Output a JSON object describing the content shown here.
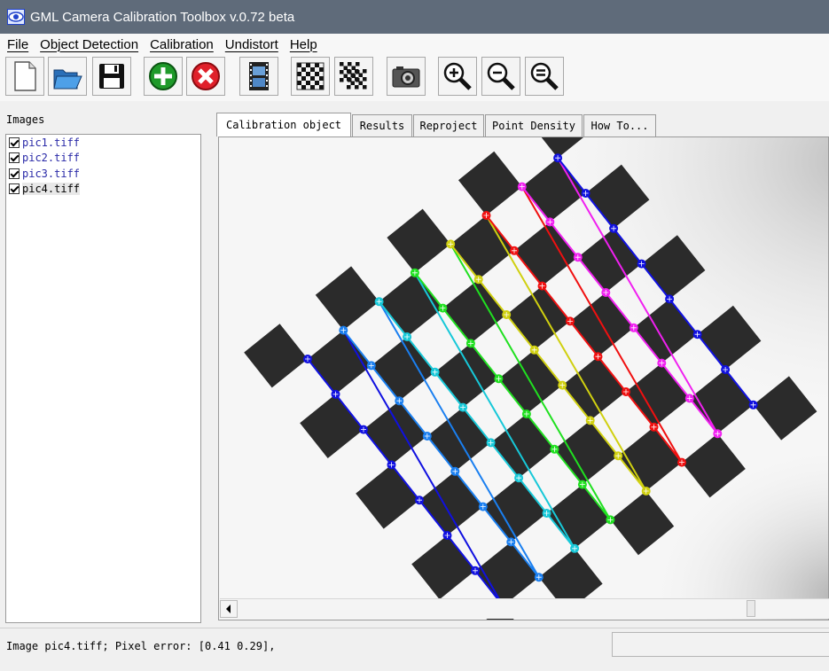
{
  "window": {
    "title": "GML Camera Calibration Toolbox  v.0.72 beta"
  },
  "menu": [
    {
      "label": "File",
      "name": "menu-file"
    },
    {
      "label": "Object Detection",
      "name": "menu-object-detection"
    },
    {
      "label": "Calibration",
      "name": "menu-calibration"
    },
    {
      "label": "Undistort",
      "name": "menu-undistort"
    },
    {
      "label": "Help",
      "name": "menu-help"
    }
  ],
  "toolbar": [
    {
      "icon": "new-document-icon",
      "name": "new-button"
    },
    {
      "icon": "open-folder-icon",
      "name": "open-button"
    },
    {
      "icon": "save-floppy-icon",
      "name": "save-button"
    },
    {
      "icon": "add-image-icon",
      "name": "add-image-button"
    },
    {
      "icon": "remove-image-icon",
      "name": "remove-image-button"
    },
    {
      "icon": "film-strip-icon",
      "name": "video-button"
    },
    {
      "icon": "checkerboard-icon",
      "name": "detect-object-button"
    },
    {
      "icon": "checkerboard-multi-icon",
      "name": "detect-all-button"
    },
    {
      "icon": "camera-icon",
      "name": "calibrate-button"
    },
    {
      "icon": "zoom-in-icon",
      "name": "zoom-in-button"
    },
    {
      "icon": "zoom-out-icon",
      "name": "zoom-out-button"
    },
    {
      "icon": "zoom-fit-icon",
      "name": "zoom-fit-button"
    }
  ],
  "images_panel": {
    "label": "Images",
    "items": [
      {
        "file": "pic1.tiff",
        "checked": true,
        "selected": false
      },
      {
        "file": "pic2.tiff",
        "checked": true,
        "selected": false
      },
      {
        "file": "pic3.tiff",
        "checked": true,
        "selected": false
      },
      {
        "file": "pic4.tiff",
        "checked": true,
        "selected": true
      }
    ]
  },
  "tabs": [
    {
      "label": "Calibration object",
      "active": true,
      "name": "tab-calibration-object"
    },
    {
      "label": "Results",
      "active": false,
      "name": "tab-results"
    },
    {
      "label": "Reproject",
      "active": false,
      "name": "tab-reproject"
    },
    {
      "label": "Point Density",
      "active": false,
      "name": "tab-point-density"
    },
    {
      "label": "How To...",
      "active": false,
      "name": "tab-how-to"
    }
  ],
  "pattern": {
    "row_colors": [
      "#1010e0",
      "#1a7ff0",
      "#17c8d8",
      "#20e020",
      "#d0d010",
      "#f01010",
      "#f020f0",
      "#1010e0"
    ],
    "square_color": "#2b2b2b"
  },
  "status": {
    "text": "Image pic4.tiff; Pixel error: [0.41  0.29],"
  }
}
